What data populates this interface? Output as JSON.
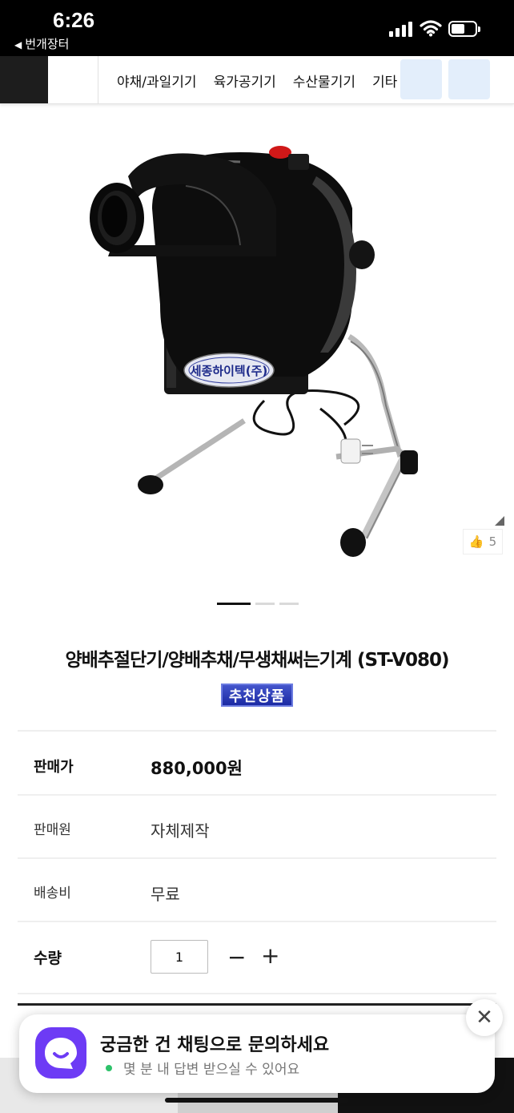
{
  "status_bar": {
    "time": "6:26",
    "back_app": "번개장터",
    "icons": [
      "signal-icon",
      "wifi-icon",
      "battery-icon"
    ]
  },
  "category_nav": {
    "items": [
      "야채/과일기기",
      "육가공기기",
      "수산물기기",
      "기타"
    ]
  },
  "gallery": {
    "image_subject": "product-photo",
    "nameplate_text": "세종하이텍(주)",
    "total_slides": 3,
    "active_slide": 1,
    "like_count": "5"
  },
  "product": {
    "title": "양배추절단기/양배추채/무생채써는기계 (ST-V080)",
    "badge": "추천상품"
  },
  "info": {
    "price_label": "판매가",
    "price_value": "880,000원",
    "seller_label": "판매원",
    "seller_value": "자체제작",
    "shipping_label": "배송비",
    "shipping_value": "무료",
    "quantity_label": "수량",
    "quantity_value": "1",
    "minus": "−",
    "plus": "+"
  },
  "chat_popup": {
    "title": "궁금한 건 채팅으로 문의하세요",
    "subtitle": "몇 분 내 답변 받으실 수 있어요",
    "close": "✕"
  },
  "colors": {
    "badge_blue": "#2436b5",
    "chat_purple": "#6d3bf5",
    "online_green": "#2ec26a",
    "nav_dark": "#1d1d1d"
  }
}
